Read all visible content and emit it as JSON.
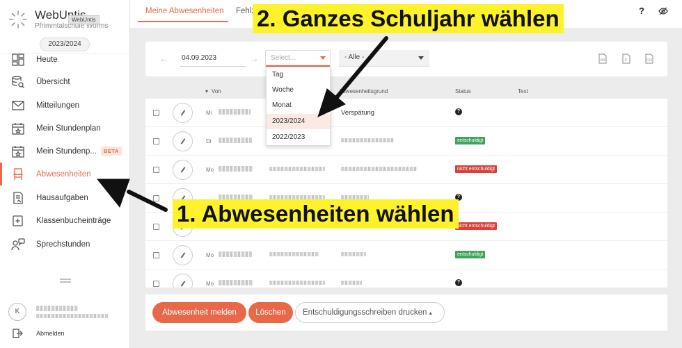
{
  "sidebar": {
    "brand_name": "WebUntis",
    "school_name": "Pfrimmtalschule Worms",
    "brand_tooltip": "WebUntis",
    "school_year": "2023/2024",
    "items": [
      {
        "label": "Heute",
        "icon": "dashboard-icon"
      },
      {
        "label": "Übersicht",
        "icon": "database-search-icon"
      },
      {
        "label": "Mitteilungen",
        "icon": "mail-icon"
      },
      {
        "label": "Mein Stundenplan",
        "icon": "calendar-icon"
      },
      {
        "label": "Mein Stundenp...",
        "icon": "calendar-icon",
        "badge": "BETA"
      },
      {
        "label": "Abwesenheiten",
        "icon": "chair-icon",
        "active": true
      },
      {
        "label": "Hausaufgaben",
        "icon": "homework-icon"
      },
      {
        "label": "Klassenbucheinträge",
        "icon": "book-plus-icon"
      },
      {
        "label": "Sprechstunden",
        "icon": "people-chat-icon"
      }
    ],
    "avatar_initial": "K",
    "logout_label": "Abmelden",
    "accent_color": "#e8694a"
  },
  "topbar": {
    "tabs": [
      {
        "label": "Meine Abwesenheiten",
        "active": true
      },
      {
        "label": "Fehlz"
      }
    ],
    "help_label": "?"
  },
  "filters": {
    "prev_label": "←",
    "next_label": "→",
    "date": "04.09.2023",
    "select_placeholder": "Select...",
    "alle_label": "- Alle -"
  },
  "dropdown": {
    "options": [
      "Tag",
      "Woche",
      "Monat",
      "2023/2024",
      "2022/2023"
    ],
    "highlighted": "2023/2024"
  },
  "table": {
    "headers": {
      "von": "Von",
      "grund": "Abwesenheitsgrund",
      "status": "Status",
      "text": "Text"
    },
    "rows": [
      {
        "day": "Mi",
        "reason": "Verspätung",
        "status_type": "unknown"
      },
      {
        "day": "Di",
        "reason": "",
        "status_type": "excused",
        "status": "entschuldigt"
      },
      {
        "day": "Mo",
        "reason": "",
        "status_type": "unexcused",
        "status": "nicht entschuldigt"
      },
      {
        "day": "",
        "reason": "",
        "status_type": "unknown"
      },
      {
        "day": "",
        "reason": "",
        "status_type": "unexcused",
        "status": "nicht entschuldigt"
      },
      {
        "day": "Mo",
        "reason": "",
        "status_type": "excused",
        "status": "entschuldigt"
      },
      {
        "day": "Mo",
        "reason": "",
        "status_type": "unknown"
      }
    ]
  },
  "actions": {
    "report_label": "Abwesenheit melden",
    "delete_label": "Löschen",
    "print_label": "Entschuldigungsschreiben drucken"
  },
  "annotations": {
    "step2": "2. Ganzes Schuljahr wählen",
    "step1": "1. Abwesenheiten wählen"
  }
}
